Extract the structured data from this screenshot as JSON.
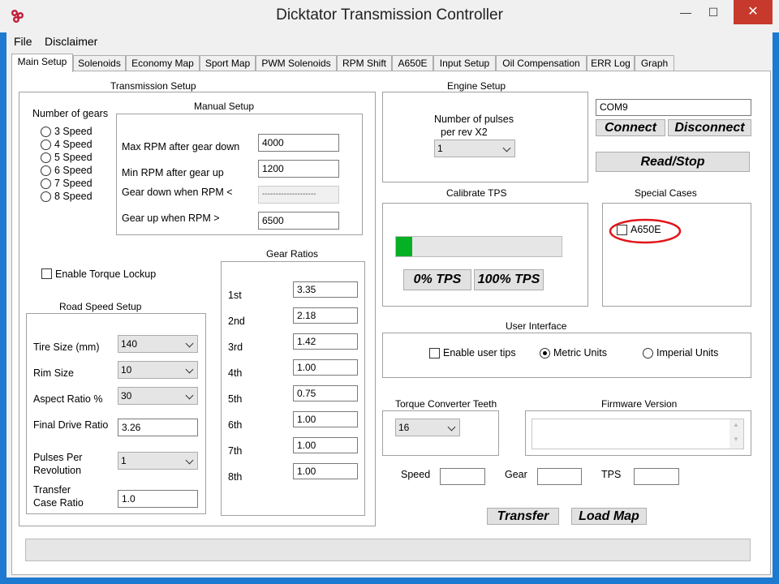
{
  "window": {
    "title": "Dicktator Transmission Controller",
    "min_glyph": "—",
    "max_glyph": "☐",
    "close_glyph": "✕"
  },
  "menu": [
    "File",
    "Disclaimer"
  ],
  "tabs": [
    "Main Setup",
    "Solenoids",
    "Economy Map",
    "Sport Map",
    "PWM Solenoids",
    "RPM Shift",
    "A650E",
    "Input Setup",
    "Oil Compensation",
    "ERR Log",
    "Graph"
  ],
  "transmission_setup": {
    "title": "Transmission Setup",
    "gears_label": "Number of gears",
    "gear_options": [
      "3 Speed",
      "4 Speed",
      "5 Speed",
      "6 Speed",
      "7 Speed",
      "8 Speed"
    ],
    "manual_setup": {
      "title": "Manual Setup",
      "max_rpm_label": "Max RPM after gear down",
      "max_rpm_value": "4000",
      "min_rpm_label": "Min RPM after gear up",
      "min_rpm_value": "1200",
      "gear_down_label": "Gear down when RPM <",
      "gear_down_value": "--------------------",
      "gear_up_label": "Gear up when RPM >",
      "gear_up_value": "6500"
    },
    "torque_lockup_label": "Enable Torque  Lockup",
    "road_speed": {
      "title": "Road Speed Setup",
      "tire_size_label": "Tire Size (mm)",
      "tire_size_value": "140",
      "rim_size_label": "Rim Size",
      "rim_size_value": "10",
      "aspect_label": "Aspect Ratio %",
      "aspect_value": "30",
      "final_drive_label": "Final Drive Ratio",
      "final_drive_value": "3.26",
      "pulses_label_1": "Pulses Per",
      "pulses_label_2": "Revolution",
      "pulses_value": "1",
      "transfer_label_1": "Transfer",
      "transfer_label_2": "Case Ratio",
      "transfer_value": "1.0"
    },
    "gear_ratios": {
      "title": "Gear Ratios",
      "items": [
        {
          "label": "1st",
          "value": "3.35"
        },
        {
          "label": "2nd",
          "value": "2.18"
        },
        {
          "label": "3rd",
          "value": "1.42"
        },
        {
          "label": "4th",
          "value": "1.00"
        },
        {
          "label": "5th",
          "value": "0.75"
        },
        {
          "label": "6th",
          "value": "1.00"
        },
        {
          "label": "7th",
          "value": "1.00"
        },
        {
          "label": "8th",
          "value": "1.00"
        }
      ]
    }
  },
  "engine_setup": {
    "title": "Engine Setup",
    "pulses_label_1": "Number of pulses",
    "pulses_label_2": "per rev X2",
    "pulses_value": "1"
  },
  "connection": {
    "port": "COM9",
    "connect": "Connect",
    "disconnect": "Disconnect",
    "read_stop": "Read/Stop"
  },
  "calibrate_tps": {
    "title": "Calibrate TPS",
    "progress": 0.1,
    "btn_0": "0% TPS",
    "btn_100": "100% TPS"
  },
  "special_cases": {
    "title": "Special Cases",
    "a650e_label": "A650E"
  },
  "user_interface": {
    "title": "User Interface",
    "tips_label": "Enable user tips",
    "metric_label": "Metric Units",
    "imperial_label": "Imperial Units"
  },
  "torque_converter": {
    "title": "Torque Converter Teeth",
    "value": "16"
  },
  "firmware": {
    "title": "Firmware Version",
    "up": "▲",
    "down": "▼"
  },
  "live": {
    "speed_label": "Speed",
    "gear_label": "Gear",
    "tps_label": "TPS"
  },
  "actions": {
    "transfer": "Transfer",
    "load_map": "Load Map"
  },
  "colors": {
    "progress": "#06b025",
    "highlight": "#e0161b",
    "accent": "#1e7ad0"
  }
}
